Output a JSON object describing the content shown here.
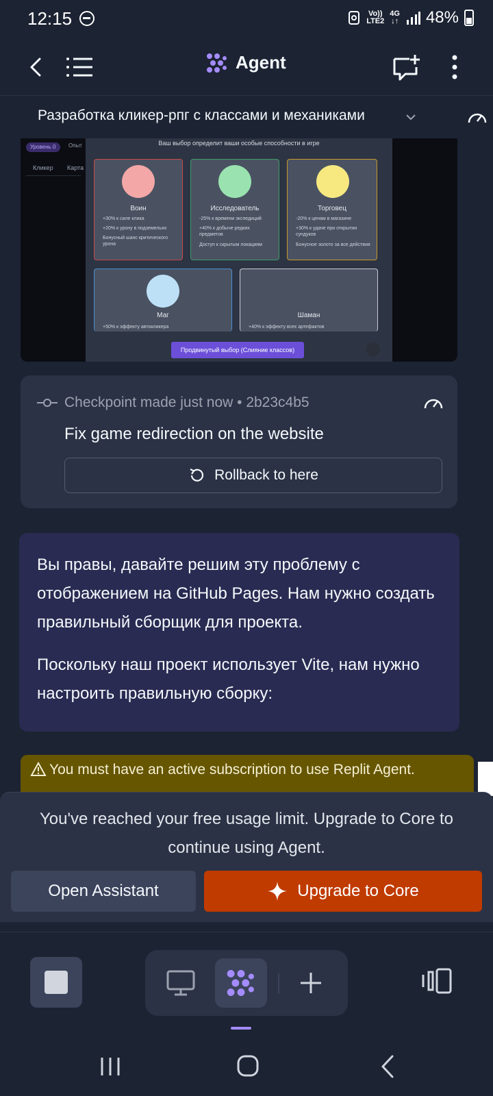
{
  "status_bar": {
    "time": "12:15",
    "network_top": "Vo))",
    "network_bottom": "LTE2",
    "network_gen": "4G",
    "battery": "48%"
  },
  "header": {
    "title": "Agent"
  },
  "project": {
    "title": "Разработка кликер-рпг с классами и механиками"
  },
  "screenshot": {
    "pill": "Уровень 0",
    "pill2": "Опыт",
    "tab1": "Кликер",
    "tab2": "Карта",
    "caption": "Ваш выбор определит ваши особые способности в игре",
    "cards": [
      {
        "name": "Воин",
        "color": "#f4a7a7",
        "border": "#c64a4a",
        "lines": [
          "+30% к силе клика",
          "+20% к урону в подземельях",
          "Бонусный шанс критического урона"
        ]
      },
      {
        "name": "Исследователь",
        "color": "#9ae3b0",
        "border": "#3f9c6a",
        "lines": [
          "-25% к времени экспедиций",
          "+40% к добыче редких предметов",
          "Доступ к скрытым локациям"
        ]
      },
      {
        "name": "Торговец",
        "color": "#f7e980",
        "border": "#c79a2a",
        "lines": [
          "-20% к ценам в магазине",
          "+30% к удаче при открытии сундуков",
          "Бонусное золото за все действия"
        ]
      },
      {
        "name": "Маг",
        "color": "#bde0f7",
        "border": "#4a8ed0",
        "lines": [
          "+50% к эффекту автокликера"
        ]
      },
      {
        "name": "Шаман",
        "color": "",
        "border": "#c9ccd3",
        "lines": [
          "+40% к эффекту всех артефактов"
        ]
      }
    ],
    "advanced_button": "Продвинутый выбор (Слияние классов)"
  },
  "checkpoint": {
    "meta": "Checkpoint made just now • 2b23c4b5",
    "message": "Fix game redirection on the website",
    "rollback_label": "Rollback to here"
  },
  "message": {
    "paragraph1": "Вы правы, давайте решим эту проблему с отображением на GitHub Pages. Нам нужно создать правильный сборщик для проекта.",
    "paragraph2": "Поскольку наш проект использует Vite, нам нужно настроить правильную сборку:"
  },
  "warning": {
    "text": "You must have an active subscription to use Replit Agent."
  },
  "limit": {
    "text": "You've reached your free usage limit. Upgrade to Core to continue using Agent.",
    "open_assistant": "Open Assistant",
    "upgrade": "Upgrade to Core"
  },
  "colors": {
    "background": "#1c2333",
    "surface": "#2b3245",
    "accent": "#a48cff",
    "upgrade": "#c03b00",
    "warning": "#665600"
  }
}
